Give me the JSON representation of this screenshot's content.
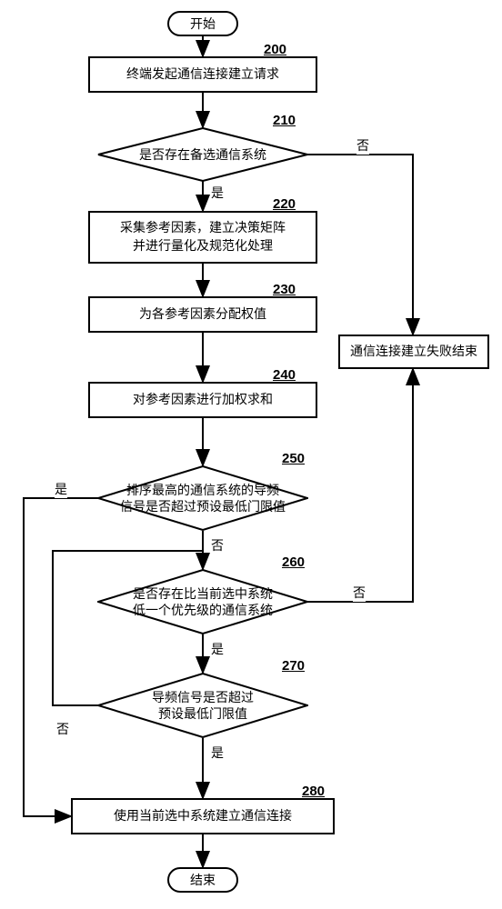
{
  "chart_data": {
    "type": "flowchart",
    "nodes": [
      {
        "id": "start",
        "kind": "terminator",
        "label": "开始"
      },
      {
        "id": "200",
        "kind": "process",
        "label": "终端发起通信连接建立请求"
      },
      {
        "id": "210",
        "kind": "decision",
        "label": "是否存在备选通信系统"
      },
      {
        "id": "220",
        "kind": "process",
        "label": "采集参考因素，建立决策矩阵\n并进行量化及规范化处理"
      },
      {
        "id": "230",
        "kind": "process",
        "label": "为各参考因素分配权值"
      },
      {
        "id": "fail",
        "kind": "process",
        "label": "通信连接建立失败结束"
      },
      {
        "id": "240",
        "kind": "process",
        "label": "对参考因素进行加权求和"
      },
      {
        "id": "250",
        "kind": "decision",
        "label": "排序最高的通信系统的导频\n信号是否超过预设最低门限值"
      },
      {
        "id": "260",
        "kind": "decision",
        "label": "是否存在比当前选中系统\n低一个优先级的通信系统"
      },
      {
        "id": "270",
        "kind": "decision",
        "label": "导频信号是否超过\n预设最低门限值"
      },
      {
        "id": "280",
        "kind": "process",
        "label": "使用当前选中系统建立通信连接"
      },
      {
        "id": "end",
        "kind": "terminator",
        "label": "结束"
      }
    ],
    "edges": [
      {
        "from": "start",
        "to": "200"
      },
      {
        "from": "200",
        "to": "210"
      },
      {
        "from": "210",
        "to": "220",
        "label": "是"
      },
      {
        "from": "210",
        "to": "fail",
        "label": "否"
      },
      {
        "from": "220",
        "to": "230"
      },
      {
        "from": "230",
        "to": "240"
      },
      {
        "from": "240",
        "to": "250"
      },
      {
        "from": "250",
        "to": "280_left",
        "label": "是"
      },
      {
        "from": "250",
        "to": "260",
        "label": "否"
      },
      {
        "from": "260",
        "to": "270",
        "label": "是"
      },
      {
        "from": "260",
        "to": "fail",
        "label": "否"
      },
      {
        "from": "270",
        "to": "280",
        "label": "是"
      },
      {
        "from": "270",
        "to": "260_loop",
        "label": "否"
      },
      {
        "from": "280",
        "to": "end"
      }
    ]
  },
  "labels": {
    "start": "开始",
    "end": "结束",
    "yes": "是",
    "no": "否",
    "n200": "终端发起通信连接建立请求",
    "n210": "是否存在备选通信系统",
    "n220a": "采集参考因素，建立决策矩阵",
    "n220b": "并进行量化及规范化处理",
    "n230": "为各参考因素分配权值",
    "nfail": "通信连接建立失败结束",
    "n240": "对参考因素进行加权求和",
    "n250a": "排序最高的通信系统的导频",
    "n250b": "信号是否超过预设最低门限值",
    "n260a": "是否存在比当前选中系统",
    "n260b": "低一个优先级的通信系统",
    "n270a": "导频信号是否超过",
    "n270b": "预设最低门限值",
    "n280": "使用当前选中系统建立通信连接",
    "num200": "200",
    "num210": "210",
    "num220": "220",
    "num230": "230",
    "num240": "240",
    "num250": "250",
    "num260": "260",
    "num270": "270",
    "num280": "280"
  }
}
